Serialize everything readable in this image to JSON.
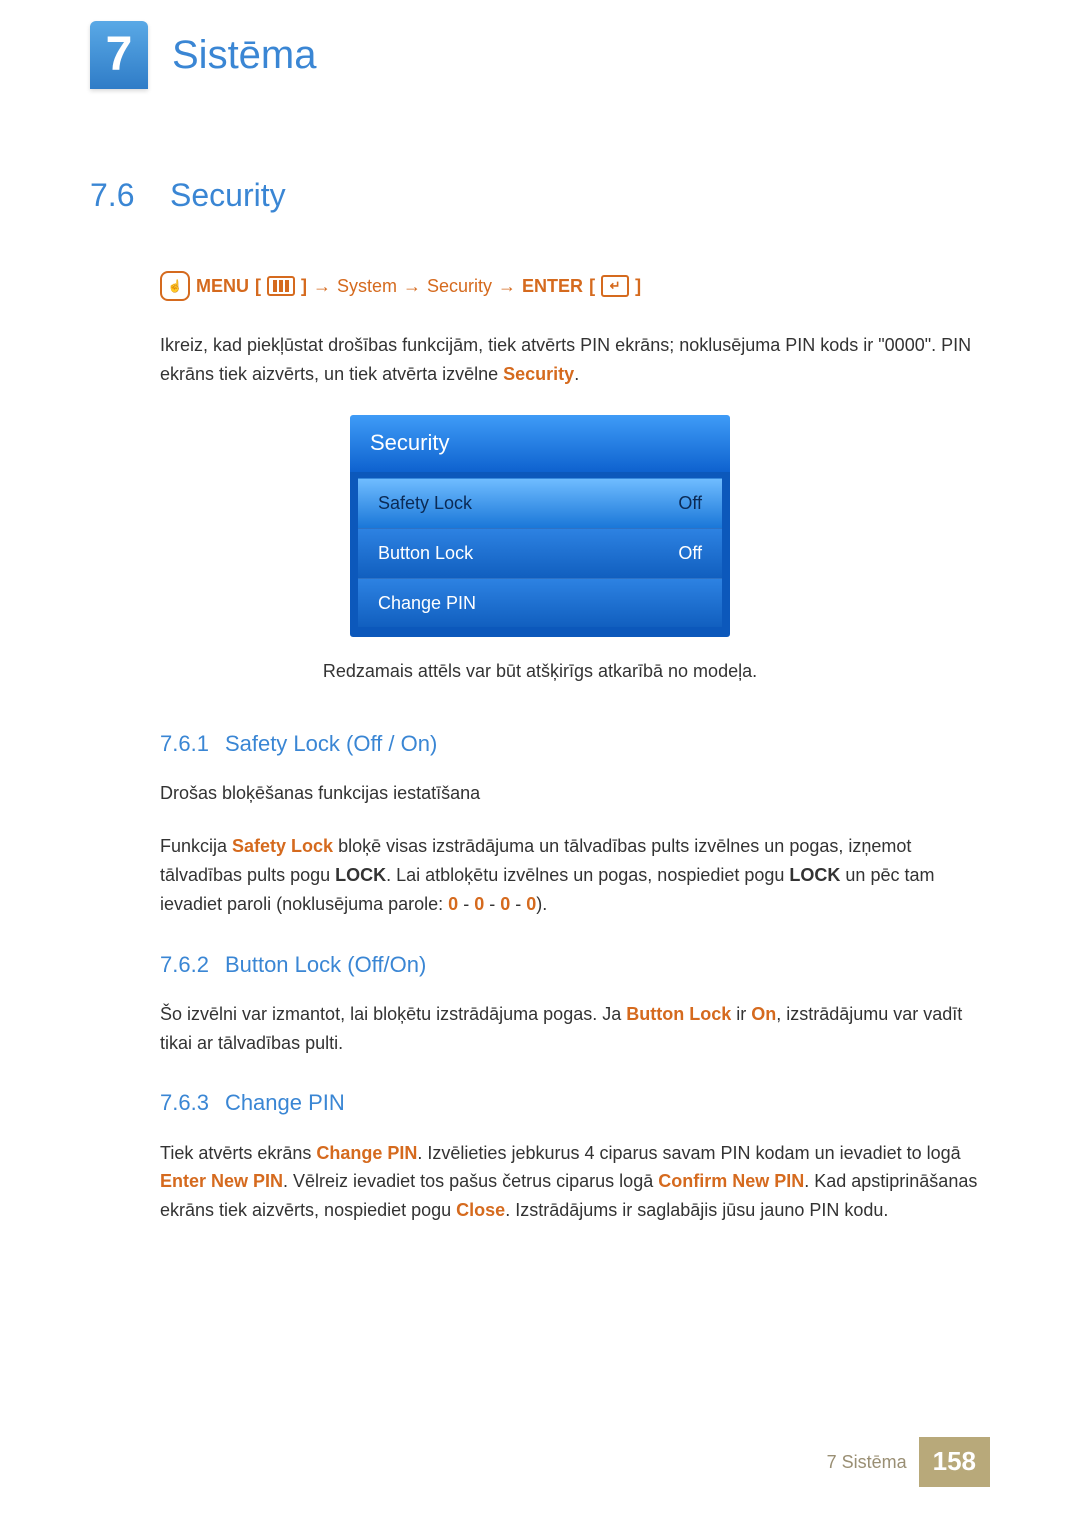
{
  "chapter": {
    "number": "7",
    "title": "Sistēma"
  },
  "section": {
    "number": "7.6",
    "title": "Security"
  },
  "navpath": {
    "menu": "MENU",
    "system": "System",
    "security": "Security",
    "enter": "ENTER"
  },
  "intro": {
    "pre": "Ikreiz, kad piekļūstat drošības funkcijām, tiek atvērts PIN ekrāns; noklusējuma PIN kods ir \"0000\". PIN ekrāns tiek aizvērts, un tiek atvērta izvēlne ",
    "hl": "Security",
    "post": "."
  },
  "menu": {
    "title": "Security",
    "rows": [
      {
        "label": "Safety Lock",
        "value": "Off"
      },
      {
        "label": "Button Lock",
        "value": "Off"
      },
      {
        "label": "Change PIN",
        "value": ""
      }
    ]
  },
  "caption": "Redzamais attēls var būt atšķirīgs atkarībā no modeļa.",
  "sub1": {
    "num": "7.6.1",
    "title": "Safety Lock (Off / On)",
    "p1": "Drošas bloķēšanas funkcijas iestatīšana",
    "p2a": "Funkcija ",
    "p2hl1": "Safety Lock",
    "p2b": " bloķē visas izstrādājuma un tālvadības pults izvēlnes un pogas, izņemot tālvadības pults pogu ",
    "p2bold1": "LOCK",
    "p2c": ". Lai atbloķētu izvēlnes un pogas, nospiediet pogu ",
    "p2bold2": "LOCK",
    "p2d": " un pēc tam ievadiet paroli (noklusējuma parole: ",
    "pin": [
      "0",
      "0",
      "0",
      "0"
    ],
    "sep": " - ",
    "p2e": ")."
  },
  "sub2": {
    "num": "7.6.2",
    "title": "Button Lock (Off/On)",
    "p1a": "Šo izvēlni var izmantot, lai bloķētu izstrādājuma pogas. Ja ",
    "hl1": "Button Lock",
    "p1b": " ir ",
    "hl2": "On",
    "p1c": ", izstrādājumu var vadīt tikai ar tālvadības pulti."
  },
  "sub3": {
    "num": "7.6.3",
    "title": "Change PIN",
    "p1a": "Tiek atvērts ekrāns ",
    "hl1": "Change PIN",
    "p1b": ". Izvēlieties jebkurus 4 ciparus savam PIN kodam un ievadiet to logā ",
    "hl2": "Enter New PIN",
    "p1c": ". Vēlreiz ievadiet tos pašus četrus ciparus logā ",
    "hl3": "Confirm New PIN",
    "p1d": ". Kad apstiprināšanas ekrāns tiek aizvērts, nospiediet pogu ",
    "hl4": "Close",
    "p1e": ". Izstrādājums ir saglabājis jūsu jauno PIN kodu."
  },
  "footer": {
    "chapter": "7 Sistēma",
    "page": "158"
  }
}
